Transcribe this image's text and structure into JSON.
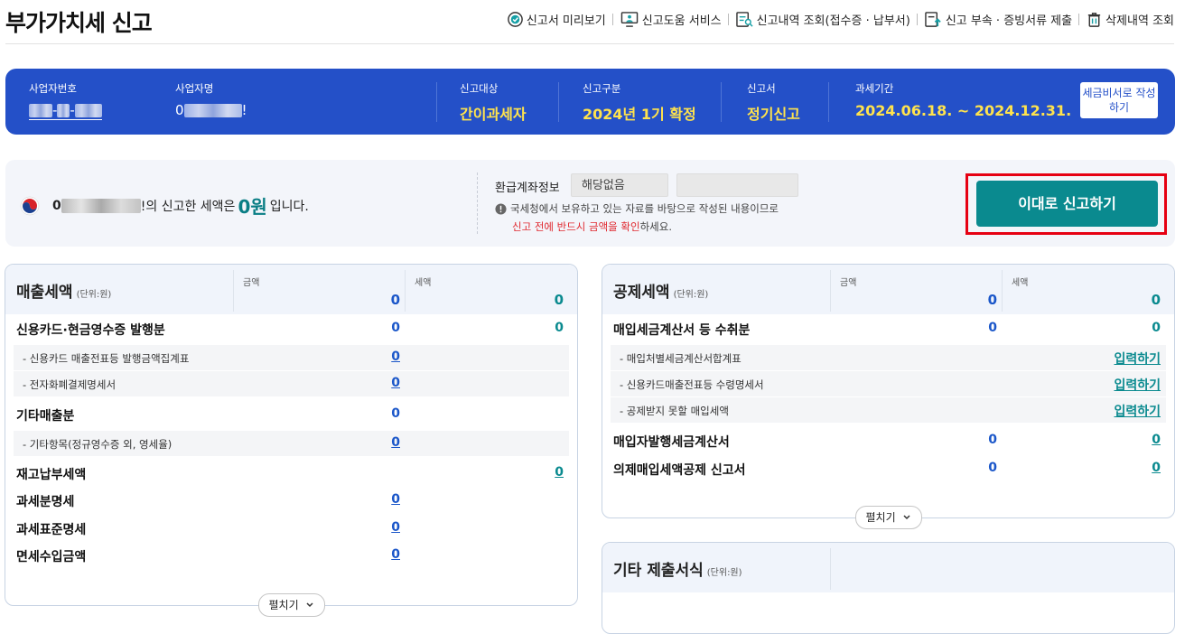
{
  "header": {
    "title": "부가가치세 신고",
    "links": [
      "신고서 미리보기",
      "신고도움 서비스",
      "신고내역 조회(접수증 · 납부서)",
      "신고 부속 · 증빙서류 제출",
      "삭제내역 조회"
    ]
  },
  "infobar": {
    "biz_no_label": "사업자번호",
    "biz_no_sep1": "-",
    "biz_no_sep2": "-",
    "biz_name_label": "사업자명",
    "biz_name_prefix": "0",
    "biz_name_suffix": "!",
    "target_label": "신고대상",
    "target_value": "간이과세자",
    "category_label": "신고구분",
    "category_value": "2024년 1기 확정",
    "form_label": "신고서",
    "form_value": "정기신고",
    "period_label": "과세기간",
    "period_value": "2024.06.18. ~ 2024.12.31.",
    "write_button": "세금비서로 작성하기"
  },
  "summary": {
    "name_prefix": "0",
    "name_suffix": "!의 신고한 세액은",
    "amount": "0원",
    "tail": "입니다.",
    "refund_label": "환급계좌정보",
    "refund_value": "해당없음",
    "notice_line1": "국세청에서 보유하고 있는 자료를 바탕으로 작성된 내용이므로",
    "notice_red": "신고 전에 반드시 금액을 확인",
    "notice_tail": "하세요.",
    "submit_button": "이대로 신고하기"
  },
  "sales_panel": {
    "title": "매출세액",
    "unit": "(단위:원)",
    "amount_label": "금액",
    "tax_label": "세액",
    "total_amount": "0",
    "total_tax": "0",
    "rows": [
      {
        "label": "신용카드·현금영수증 발행분",
        "amount": "0",
        "tax": "0"
      },
      {
        "label": "- 신용카드 매출전표등 발행금액집계표",
        "amount": "0"
      },
      {
        "label": "- 전자화폐결제명세서",
        "amount": "0"
      },
      {
        "label": "기타매출분",
        "amount": "0"
      },
      {
        "label": "- 기타항목(정규영수증 외, 영세율)",
        "amount": "0"
      },
      {
        "label": "재고납부세액",
        "tax": "0"
      },
      {
        "label": "과세분명세",
        "amount": "0"
      },
      {
        "label": "과세표준명세",
        "amount": "0"
      },
      {
        "label": "면세수입금액",
        "amount": "0"
      }
    ],
    "expand": "펼치기"
  },
  "deduction_panel": {
    "title": "공제세액",
    "unit": "(단위:원)",
    "amount_label": "금액",
    "tax_label": "세액",
    "total_amount": "0",
    "total_tax": "0",
    "rows": [
      {
        "label": "매입세금계산서 등 수취분",
        "amount": "0",
        "tax": "0"
      },
      {
        "label": "- 매입처별세금계산서합계표",
        "link": "입력하기"
      },
      {
        "label": "- 신용카드매출전표등 수령명세서",
        "link": "입력하기"
      },
      {
        "label": "- 공제받지 못할 매입세액",
        "link": "입력하기"
      },
      {
        "label": "매입자발행세금계산서",
        "amount": "0",
        "tax": "0"
      },
      {
        "label": "의제매입세액공제 신고서",
        "amount": "0",
        "tax": "0"
      }
    ],
    "expand": "펼치기"
  },
  "other_panel": {
    "title": "기타 제출서식",
    "unit": "(단위:원)"
  }
}
